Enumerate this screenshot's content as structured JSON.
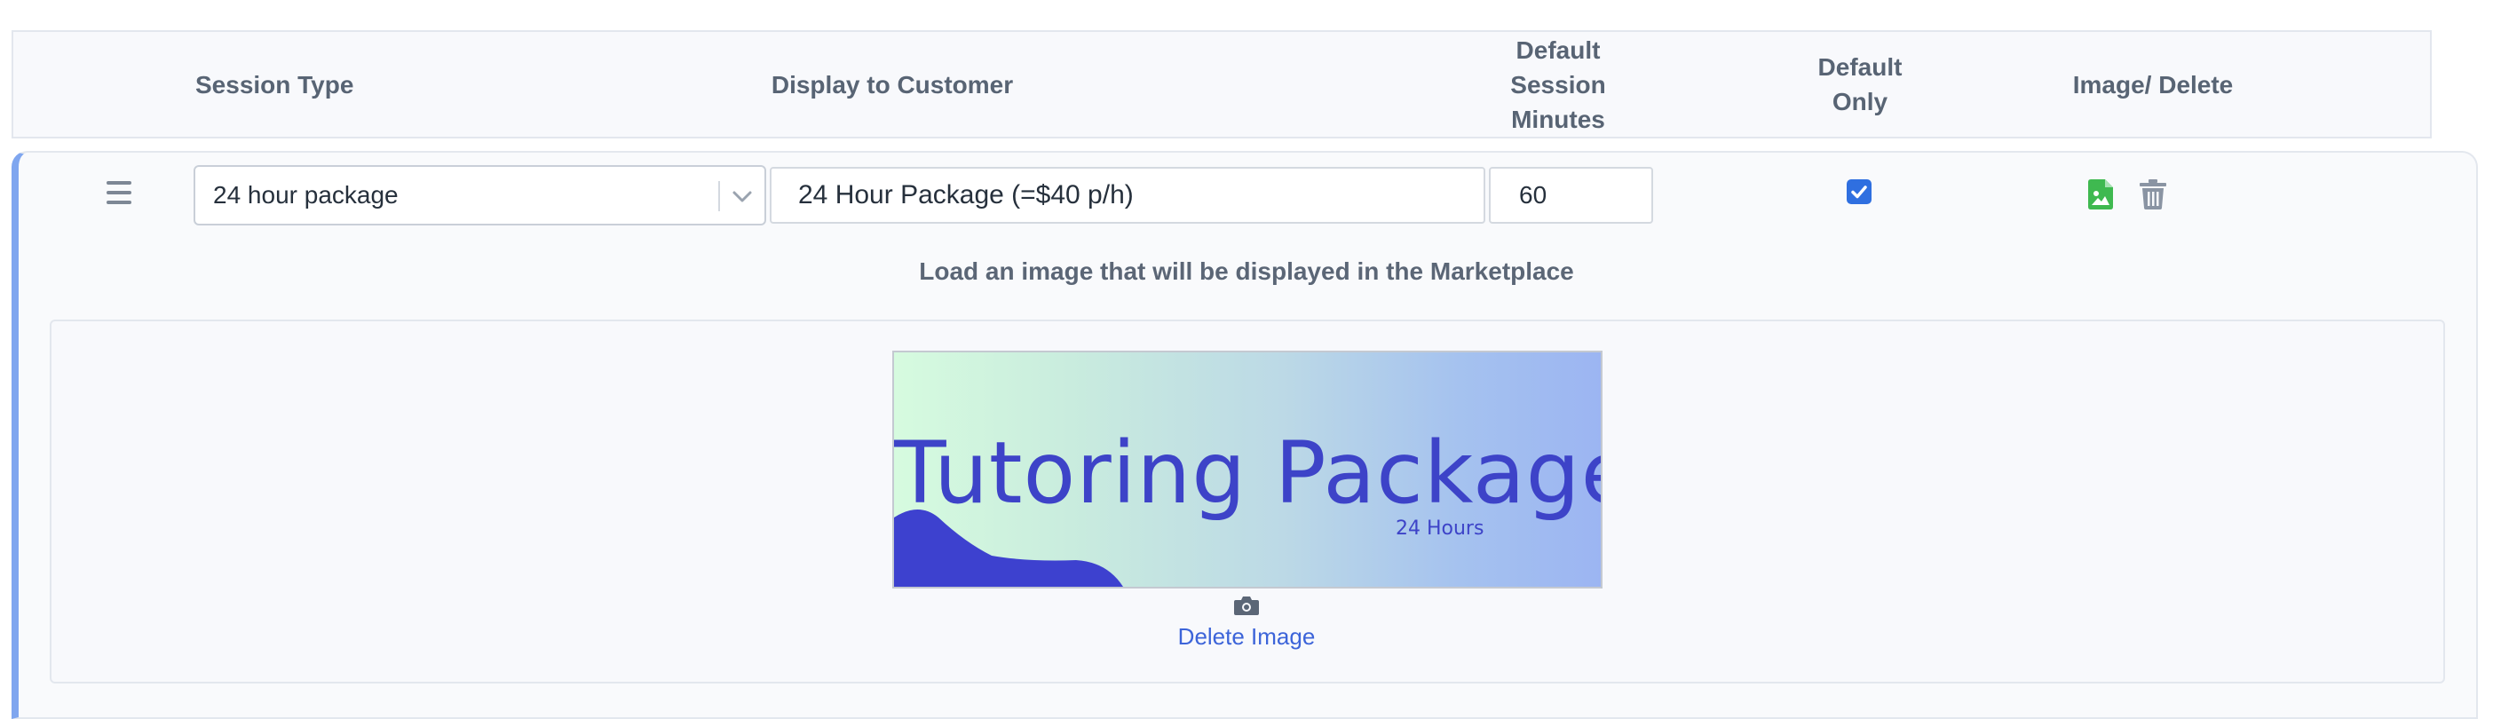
{
  "header": {
    "session_type": "Session Type",
    "display_to_customer": "Display to Customer",
    "default_session_minutes": "Default\nSession\nMinutes",
    "default_only": "Default\nOnly",
    "image_delete": "Image/ Delete"
  },
  "row": {
    "session_type_value": "24 hour package",
    "display_value": "24 Hour Package (=$40 p/h)",
    "minutes_value": "60",
    "default_only_checked": true
  },
  "upload": {
    "label": "Load an image that will be displayed in the Marketplace",
    "banner_title": "Tutoring Package",
    "banner_subtitle": "24 Hours",
    "delete_link": "Delete Image"
  },
  "colors": {
    "accent": "#2f6fe0",
    "link": "#3c64d9",
    "image_icon": "#3fb950",
    "trash_icon": "#8a94a3",
    "banner_text": "#3d43c8"
  },
  "icons": [
    "drag-handle-icon",
    "chevron-down-icon",
    "checkbox-checked-icon",
    "image-file-icon",
    "trash-icon",
    "camera-icon"
  ]
}
